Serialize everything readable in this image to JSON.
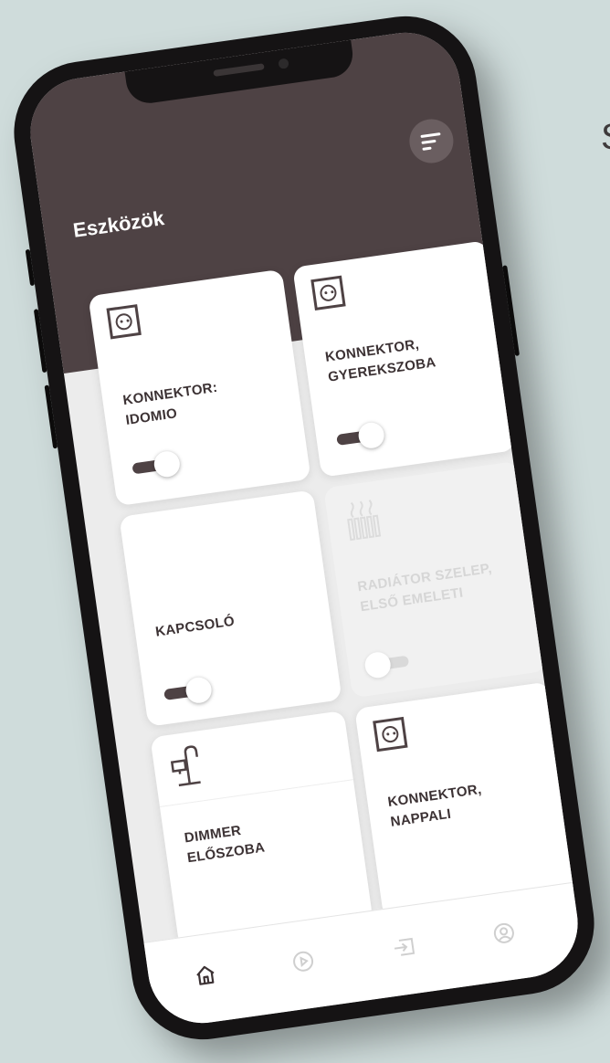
{
  "edge_letter": "S",
  "header": {
    "title": "Eszközök"
  },
  "devices": [
    {
      "label": "KONNEKTOR: IDOMIO",
      "icon": "socket-icon",
      "switch_on": true,
      "enabled": true
    },
    {
      "label": "KONNEKTOR, GYEREKSZOBA",
      "icon": "socket-icon",
      "switch_on": true,
      "enabled": true
    },
    {
      "label": "KAPCSOLÓ",
      "icon": "",
      "switch_on": true,
      "enabled": true
    },
    {
      "label": "RADIÁTOR SZELEP, ELSŐ EMELETI",
      "icon": "radiator-icon",
      "switch_on": false,
      "enabled": false
    },
    {
      "label": "DIMMER ELŐSZOBA",
      "icon": "lamp-icon",
      "enabled": true
    },
    {
      "label": "KONNEKTOR, NAPPALI",
      "icon": "socket-icon",
      "enabled": true
    }
  ],
  "bottom_nav": [
    {
      "icon": "home-icon",
      "active": true
    },
    {
      "icon": "play-circle-icon",
      "active": false
    },
    {
      "icon": "login-icon",
      "active": false
    },
    {
      "icon": "profile-icon",
      "active": false
    }
  ],
  "colors": {
    "brand": "#4e4244",
    "background": "#cfdcdb",
    "card": "#ffffff"
  }
}
